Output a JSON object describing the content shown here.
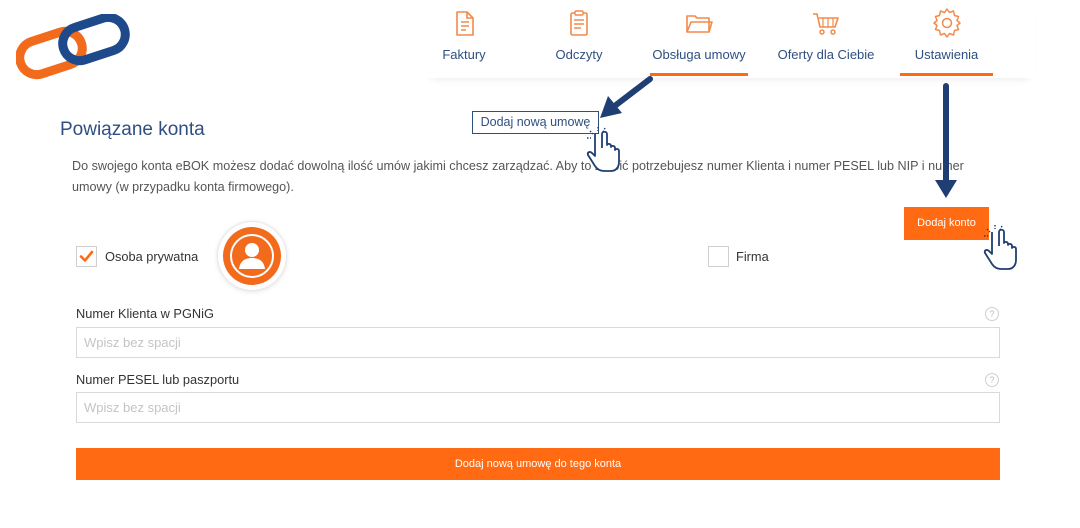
{
  "colors": {
    "accent": "#ff6a13",
    "brand_blue": "#2f4f80",
    "logo_orange": "#f26a1b"
  },
  "nav": {
    "items": [
      {
        "label": "Faktury",
        "icon": "invoice-icon"
      },
      {
        "label": "Odczyty",
        "icon": "clipboard-icon"
      },
      {
        "label": "Obsługa umowy",
        "icon": "folder-icon",
        "active": true
      },
      {
        "label": "Oferty dla Ciebie",
        "icon": "cart-icon"
      },
      {
        "label": "Ustawienia",
        "icon": "gear-icon",
        "active": true
      }
    ]
  },
  "page": {
    "title": "Powiązane konta",
    "add_contract_link": "Dodaj nową umowę",
    "intro": "Do swojego konta eBOK możesz dodać dowolną ilość umów jakimi chcesz zarządzać. Aby to zrobić potrzebujesz numer Klienta i numer PESEL lub NIP i numer umowy (w przypadku konta firmowego).",
    "add_account_button": "Dodaj konto"
  },
  "form": {
    "account_types": [
      {
        "label": "Osoba prywatna",
        "checked": true
      },
      {
        "label": "Firma",
        "checked": false
      }
    ],
    "fields": [
      {
        "label": "Numer Klienta w PGNiG",
        "placeholder": "Wpisz bez spacji",
        "value": ""
      },
      {
        "label": "Numer PESEL lub paszportu",
        "placeholder": "Wpisz bez spacji",
        "value": ""
      }
    ],
    "help_symbol": "?",
    "submit_label": "Dodaj nową umowę do tego konta"
  }
}
